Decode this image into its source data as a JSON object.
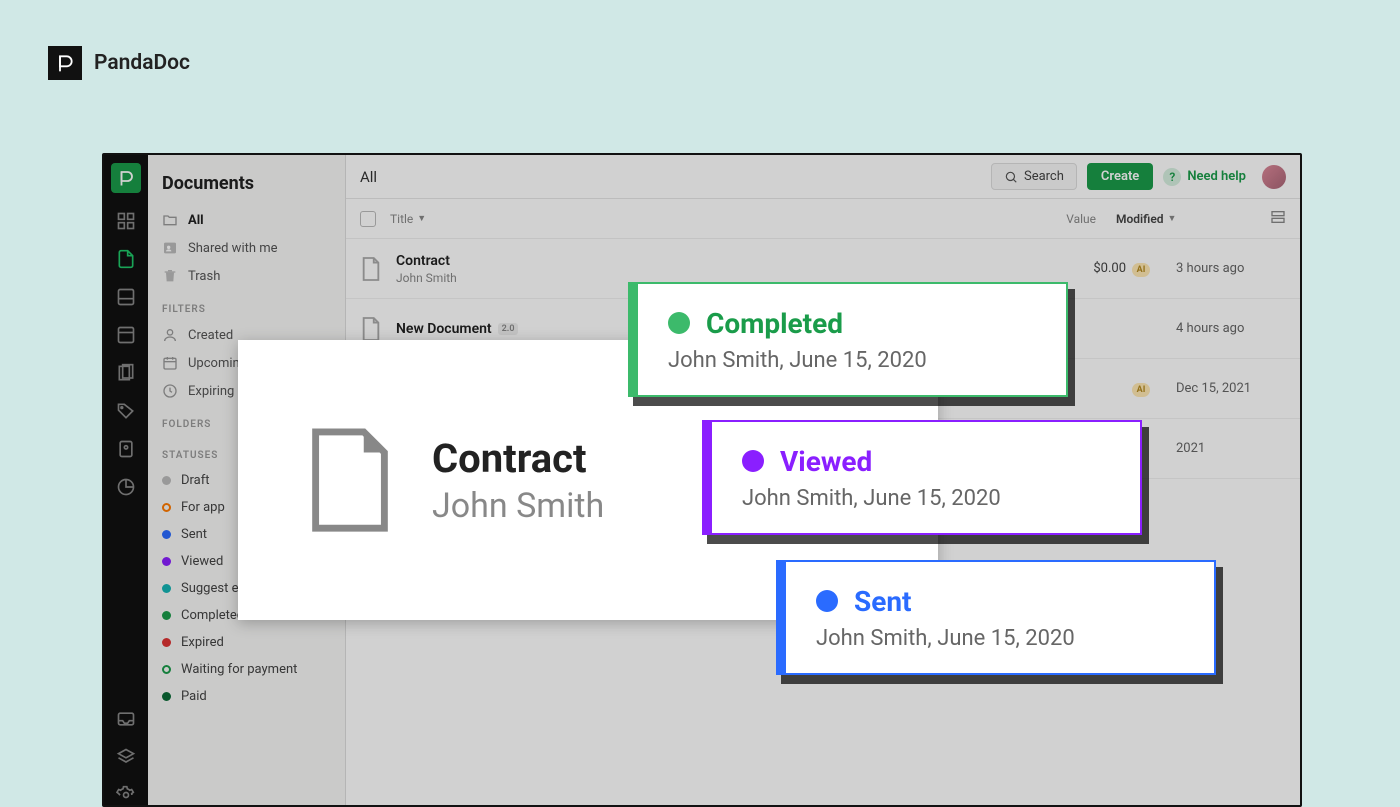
{
  "brand": {
    "name": "PandaDoc"
  },
  "sidebar": {
    "title": "Documents",
    "items": [
      {
        "label": "All",
        "active": true
      },
      {
        "label": "Shared with me",
        "active": false
      },
      {
        "label": "Trash",
        "active": false
      }
    ],
    "filters_header": "FILTERS",
    "filters": [
      {
        "label": "Created"
      },
      {
        "label": "Upcoming"
      },
      {
        "label": "Expiring"
      }
    ],
    "folders_header": "FOLDERS",
    "statuses_header": "STATUSES",
    "statuses": [
      {
        "label": "Draft",
        "color": "#bbbbbb",
        "ring": false
      },
      {
        "label": "For app",
        "color": "#ff7a00",
        "ring": true
      },
      {
        "label": "Sent",
        "color": "#2a6bff",
        "ring": false
      },
      {
        "label": "Viewed",
        "color": "#8a1fff",
        "ring": false
      },
      {
        "label": "Suggest edits",
        "color": "#14b4b4",
        "ring": false
      },
      {
        "label": "Completed",
        "color": "#1a9c4a",
        "ring": false
      },
      {
        "label": "Expired",
        "color": "#d33",
        "ring": false
      },
      {
        "label": "Waiting for payment",
        "color": "#1a9c4a",
        "ring": true
      },
      {
        "label": "Paid",
        "color": "#0a6b36",
        "ring": false
      }
    ]
  },
  "topbar": {
    "title": "All",
    "search": "Search",
    "create": "Create",
    "help": "Need help"
  },
  "list": {
    "columns": {
      "title": "Title",
      "value": "Value",
      "modified": "Modified"
    },
    "rows": [
      {
        "title": "Contract",
        "subtitle": "John Smith",
        "value": "$0.00",
        "badge": "AI",
        "time": "3 hours ago",
        "version": ""
      },
      {
        "title": "New Document",
        "subtitle": "",
        "value": "",
        "badge": "",
        "time": "4 hours ago",
        "version": "2.0"
      },
      {
        "title": "",
        "subtitle": "",
        "value": "",
        "badge": "",
        "time": "Dec 15, 2021",
        "version": ""
      },
      {
        "title": "",
        "subtitle": "",
        "value": "",
        "badge": "",
        "time": "2021",
        "version": ""
      }
    ]
  },
  "big_card": {
    "title": "Contract",
    "subtitle": "John Smith"
  },
  "status_cards": {
    "completed": {
      "label": "Completed",
      "sub": "John Smith, June 15, 2020",
      "color": "#3cba6b"
    },
    "viewed": {
      "label": "Viewed",
      "sub": "John Smith, June 15, 2020",
      "color": "#8a1fff"
    },
    "sent": {
      "label": "Sent",
      "sub": "John Smith, June 15, 2020",
      "color": "#2a6bff"
    }
  }
}
